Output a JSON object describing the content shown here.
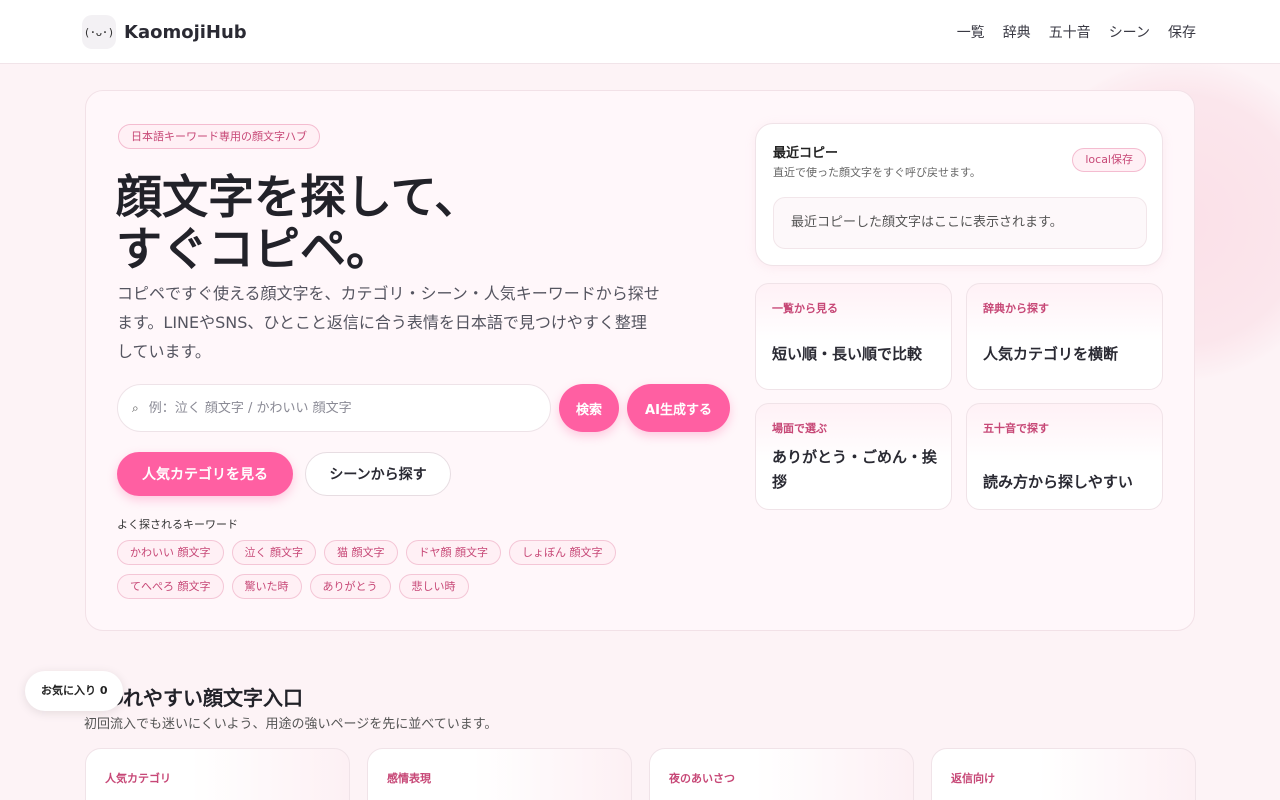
{
  "header": {
    "logo_glyph": "(･ᴗ･)",
    "brand": "KaomojiHub",
    "nav": [
      "一覧",
      "辞典",
      "五十音",
      "シーン",
      "保存"
    ]
  },
  "hero": {
    "tag": "日本語キーワード専用の顔文字ハブ",
    "title_line1": "顔文字を探して、",
    "title_line2": "すぐコピペ。",
    "description": "コピペですぐ使える顔文字を、カテゴリ・シーン・人気キーワードから探せます。LINEやSNS、ひとこと返信に合う表情を日本語で見つけやすく整理しています。",
    "search": {
      "icon": "search-icon",
      "icon_glyph": "⌕",
      "placeholder": "例：泣く 顔文字 / かわいい 顔文字"
    },
    "search_button": "検索",
    "ai_button": "AI生成する",
    "category_button": "人気カテゴリを見る",
    "scene_button": "シーンから探す",
    "keywords_label": "よく探されるキーワード",
    "keywords": [
      "かわいい 顔文字",
      "泣く 顔文字",
      "猫 顔文字",
      "ドヤ顔 顔文字",
      "しょぼん 顔文字",
      "てへぺろ 顔文字",
      "驚いた時",
      "ありがとう",
      "悲しい時"
    ]
  },
  "recent": {
    "title": "最近コピー",
    "subtitle": "直近で使った顔文字をすぐ呼び戻せます。",
    "badge": "local保存",
    "empty": "最近コピーした顔文字はここに表示されます。"
  },
  "quick_cards": [
    {
      "label": "一覧から見る",
      "text": "短い順・長い順で比較"
    },
    {
      "label": "辞典から探す",
      "text": "人気カテゴリを横断"
    },
    {
      "label": "場面で選ぶ",
      "text": "ありがとう・ごめん・挨拶"
    },
    {
      "label": "五十音で探す",
      "text": "読み方から探しやすい"
    }
  ],
  "section": {
    "title": "使われやすい顔文字入口",
    "subtitle": "初回流入でも迷いにくいよう、用途の強いページを先に並べています。"
  },
  "favorites": "お気に入り 0",
  "bottom_cards": [
    "人気カテゴリ",
    "感情表現",
    "夜のあいさつ",
    "返信向け"
  ],
  "colors": {
    "accent": "#ff5fa2",
    "accent_text": "#c74877",
    "background": "#fdf3f6"
  }
}
